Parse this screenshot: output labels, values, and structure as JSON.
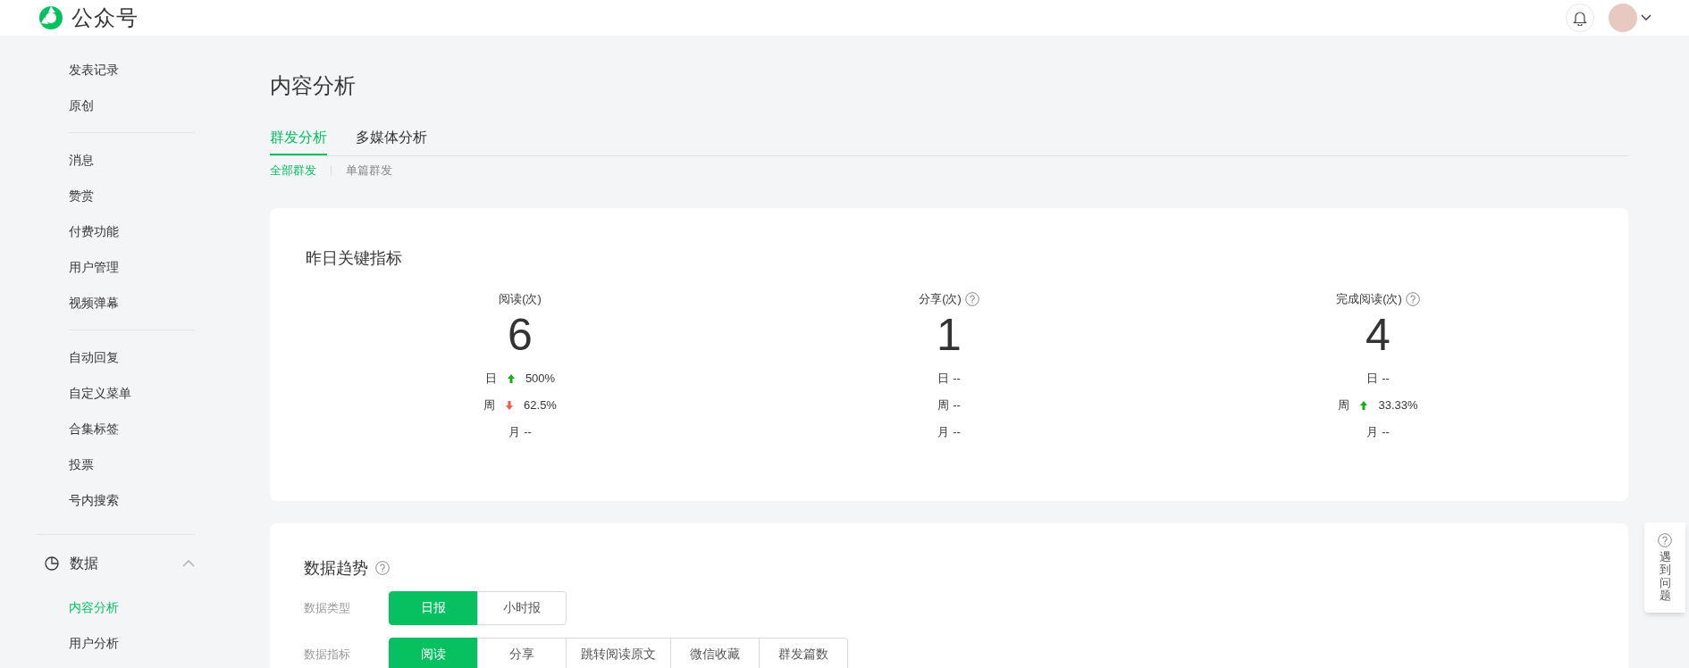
{
  "header": {
    "logo_text": "公众号"
  },
  "sidebar": {
    "groups": [
      [
        {
          "label": "发表记录",
          "selected": false
        },
        {
          "label": "原创",
          "selected": false
        }
      ],
      [
        {
          "label": "消息",
          "selected": false
        },
        {
          "label": "赞赏",
          "selected": false
        },
        {
          "label": "付费功能",
          "selected": false
        },
        {
          "label": "用户管理",
          "selected": false
        },
        {
          "label": "视频弹幕",
          "selected": false
        }
      ],
      [
        {
          "label": "自动回复",
          "selected": false
        },
        {
          "label": "自定义菜单",
          "selected": false
        },
        {
          "label": "合集标签",
          "selected": false
        },
        {
          "label": "投票",
          "selected": false
        },
        {
          "label": "号内搜索",
          "selected": false
        }
      ]
    ],
    "section": {
      "label": "数据",
      "expanded": true,
      "children": [
        {
          "label": "内容分析",
          "selected": true
        },
        {
          "label": "用户分析",
          "selected": false
        }
      ]
    }
  },
  "page_title": "内容分析",
  "tabs": [
    {
      "label": "群发分析",
      "selected": true
    },
    {
      "label": "多媒体分析",
      "selected": false
    }
  ],
  "subtabs": [
    {
      "label": "全部群发",
      "selected": true
    },
    {
      "label": "单篇群发",
      "selected": false
    }
  ],
  "key_metrics": {
    "title": "昨日关键指标",
    "metrics": [
      {
        "label": "阅读(次)",
        "help": false,
        "value": "6",
        "rows": [
          {
            "period": "日",
            "kind": "up",
            "change": "500%"
          },
          {
            "period": "周",
            "kind": "down",
            "change": "62.5%"
          },
          {
            "period": "月",
            "kind": "flat",
            "change": "--"
          }
        ]
      },
      {
        "label": "分享(次)",
        "help": true,
        "value": "1",
        "rows": [
          {
            "period": "日",
            "kind": "flat",
            "change": "--"
          },
          {
            "period": "周",
            "kind": "flat",
            "change": "--"
          },
          {
            "period": "月",
            "kind": "flat",
            "change": "--"
          }
        ]
      },
      {
        "label": "完成阅读(次)",
        "help": true,
        "value": "4",
        "rows": [
          {
            "period": "日",
            "kind": "flat",
            "change": "--"
          },
          {
            "period": "周",
            "kind": "up",
            "change": "33.33%"
          },
          {
            "period": "月",
            "kind": "flat",
            "change": "--"
          }
        ]
      }
    ]
  },
  "data_trend": {
    "title": "数据趋势",
    "help": true,
    "filters": [
      {
        "label": "数据类型",
        "options": [
          {
            "label": "日报",
            "selected": true
          },
          {
            "label": "小时报",
            "selected": false
          }
        ]
      },
      {
        "label": "数据指标",
        "options": [
          {
            "label": "阅读",
            "selected": true
          },
          {
            "label": "分享",
            "selected": false
          },
          {
            "label": "跳转阅读原文",
            "selected": false
          },
          {
            "label": "微信收藏",
            "selected": false
          },
          {
            "label": "群发篇数",
            "selected": false
          }
        ]
      }
    ]
  },
  "help_widget": {
    "text": "遇到问题"
  }
}
